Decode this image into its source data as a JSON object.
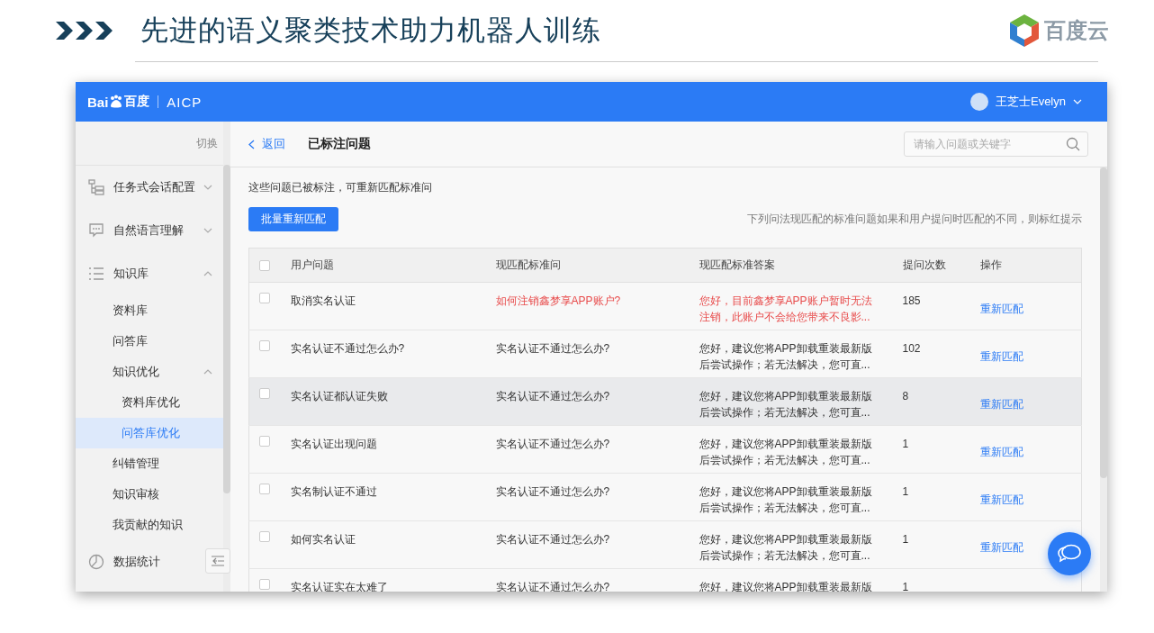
{
  "slide": {
    "title": "先进的语义聚类技术助力机器人训练",
    "logo_text": "百度云"
  },
  "app": {
    "brand": "Bai",
    "brand_cn": "百度",
    "product": "AICP",
    "user": "王芝士Evelyn"
  },
  "sidebar": {
    "switch_label": "切换",
    "items": [
      {
        "label": "任务式会话配置",
        "expanded": false,
        "selected": false
      },
      {
        "label": "自然语言理解",
        "expanded": false,
        "selected": false
      },
      {
        "label": "知识库",
        "expanded": true,
        "selected": false,
        "children": [
          {
            "label": "资料库",
            "selected": false
          },
          {
            "label": "问答库",
            "selected": false
          },
          {
            "label": "知识优化",
            "expanded": true,
            "selected": false,
            "children": [
              {
                "label": "资料库优化",
                "selected": false
              },
              {
                "label": "问答库优化",
                "selected": true
              }
            ]
          },
          {
            "label": "纠错管理",
            "selected": false
          },
          {
            "label": "知识审核",
            "selected": false
          },
          {
            "label": "我贡献的知识",
            "selected": false
          }
        ]
      },
      {
        "label": "数据统计",
        "selected": false
      }
    ]
  },
  "page": {
    "back": "返回",
    "title": "已标注问题",
    "search": {
      "placeholder": "请输入问题或关键字"
    },
    "description": "这些问题已被标注，可重新匹配标准问",
    "batch_button": "批量重新匹配",
    "hint": "下列问法现匹配的标准问题如果和用户提问时匹配的不同，则标红提示"
  },
  "table": {
    "all_checked": false,
    "columns": [
      "用户问题",
      "现匹配标准问",
      "现匹配标准答案",
      "提问次数",
      "操作"
    ],
    "rows": [
      {
        "checked": false,
        "highlighted": false,
        "mismatch": true,
        "question": "取消实名认证",
        "standard": "如何注销鑫梦享APP账户?",
        "answer": "您好，目前鑫梦享APP账户暂时无法注销，此账户不会给您带来不良影...",
        "count": "185",
        "action": "重新匹配"
      },
      {
        "checked": false,
        "highlighted": false,
        "mismatch": false,
        "question": "实名认证不通过怎么办?",
        "standard": "实名认证不通过怎么办?",
        "answer": "您好，建议您将APP卸载重装最新版后尝试操作；若无法解决，您可直...",
        "count": "102",
        "action": "重新匹配"
      },
      {
        "checked": false,
        "highlighted": true,
        "mismatch": false,
        "question": "实名认证都认证失败",
        "standard": "实名认证不通过怎么办?",
        "answer": "您好，建议您将APP卸载重装最新版后尝试操作；若无法解决，您可直...",
        "count": "8",
        "action": "重新匹配"
      },
      {
        "checked": false,
        "highlighted": false,
        "mismatch": false,
        "question": "实名认证出现问题",
        "standard": "实名认证不通过怎么办?",
        "answer": "您好，建议您将APP卸载重装最新版后尝试操作；若无法解决，您可直...",
        "count": "1",
        "action": "重新匹配"
      },
      {
        "checked": false,
        "highlighted": false,
        "mismatch": false,
        "question": "实名制认证不通过",
        "standard": "实名认证不通过怎么办?",
        "answer": "您好，建议您将APP卸载重装最新版后尝试操作；若无法解决，您可直...",
        "count": "1",
        "action": "重新匹配"
      },
      {
        "checked": false,
        "highlighted": false,
        "mismatch": false,
        "question": "如何实名认证",
        "standard": "实名认证不通过怎么办?",
        "answer": "您好，建议您将APP卸载重装最新版后尝试操作；若无法解决，您可直...",
        "count": "1",
        "action": "重新匹配"
      },
      {
        "checked": false,
        "highlighted": false,
        "mismatch": false,
        "question": "实名认证实在太难了",
        "standard": "实名认证不通过怎么办?",
        "answer": "您好，建议您将APP卸载重装最新版",
        "count": "1"
      }
    ]
  }
}
